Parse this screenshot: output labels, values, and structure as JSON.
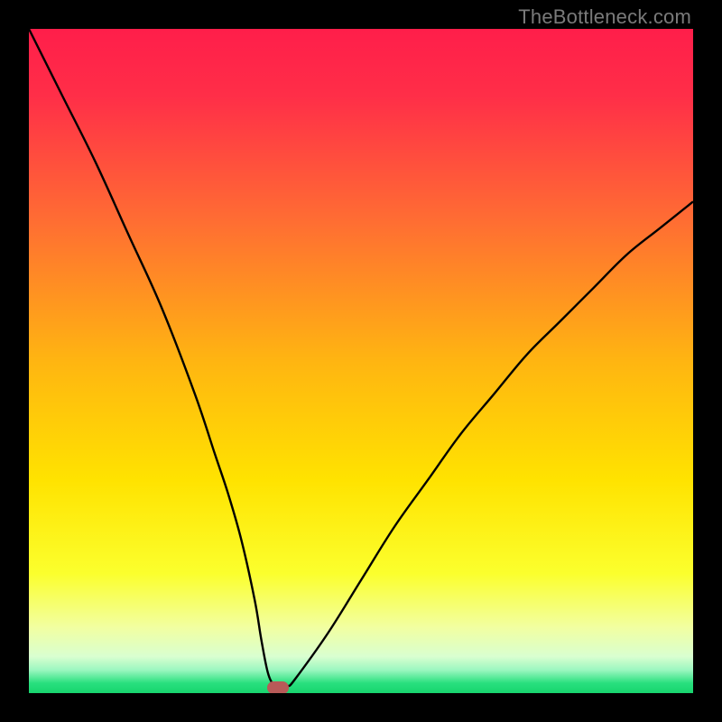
{
  "watermark": "TheBottleneck.com",
  "colors": {
    "background_black": "#000000",
    "gradient_stops": [
      {
        "pos": 0.0,
        "color": "#ff1e4a"
      },
      {
        "pos": 0.1,
        "color": "#ff2e48"
      },
      {
        "pos": 0.28,
        "color": "#ff6a34"
      },
      {
        "pos": 0.5,
        "color": "#ffb511"
      },
      {
        "pos": 0.68,
        "color": "#ffe300"
      },
      {
        "pos": 0.82,
        "color": "#fbff2d"
      },
      {
        "pos": 0.9,
        "color": "#f2ffa0"
      },
      {
        "pos": 0.945,
        "color": "#d9ffd0"
      },
      {
        "pos": 0.965,
        "color": "#9cf7c0"
      },
      {
        "pos": 0.985,
        "color": "#28e07e"
      },
      {
        "pos": 1.0,
        "color": "#18d46e"
      }
    ],
    "curve": "#000000",
    "marker": "#b85a58"
  },
  "chart_data": {
    "type": "line",
    "title": "",
    "xlabel": "",
    "ylabel": "",
    "xlim": [
      0,
      100
    ],
    "ylim": [
      0,
      100
    ],
    "series": [
      {
        "name": "bottleneck-curve",
        "x": [
          0,
          5,
          10,
          15,
          20,
          25,
          28,
          30,
          32,
          34,
          35,
          36,
          37,
          38,
          39,
          40,
          45,
          50,
          55,
          60,
          65,
          70,
          75,
          80,
          85,
          90,
          95,
          100
        ],
        "y": [
          100,
          90,
          80,
          69,
          58,
          45,
          36,
          30,
          23,
          14,
          8,
          3,
          1,
          0,
          1,
          2,
          9,
          17,
          25,
          32,
          39,
          45,
          51,
          56,
          61,
          66,
          70,
          74
        ]
      }
    ],
    "marker": {
      "x": 37.5,
      "y": 0.8
    },
    "legend": false,
    "grid": false
  }
}
